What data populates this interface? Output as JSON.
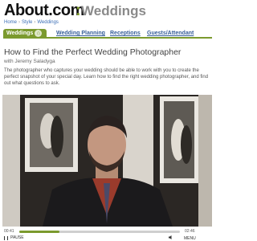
{
  "header": {
    "logo": "About.com",
    "separator": ":",
    "section": "Weddings"
  },
  "breadcrumb": [
    "Home",
    "Style",
    "Weddings"
  ],
  "tabs": [
    {
      "label": "Weddings",
      "active": true
    },
    {
      "label": "Wedding Planning",
      "active": false
    },
    {
      "label": "Receptions",
      "active": false
    },
    {
      "label": "Guests/Attendant",
      "active": false
    }
  ],
  "article": {
    "title": "How to Find the Perfect Wedding Photographer",
    "byline": "with Jeremy Saladyga",
    "description": "The photographer who captures your wedding should be able to work with you to create the perfect snapshot of your special day. Learn how to find the right wedding photographer, and find out what questions to ask."
  },
  "player": {
    "time_elapsed": "00:41",
    "time_total": "02:46",
    "progress": 0.25,
    "pause_label": "PAUSE",
    "menu_label": "MENU"
  },
  "colors": {
    "accent": "#7b9a2e",
    "link": "#375f9a"
  }
}
